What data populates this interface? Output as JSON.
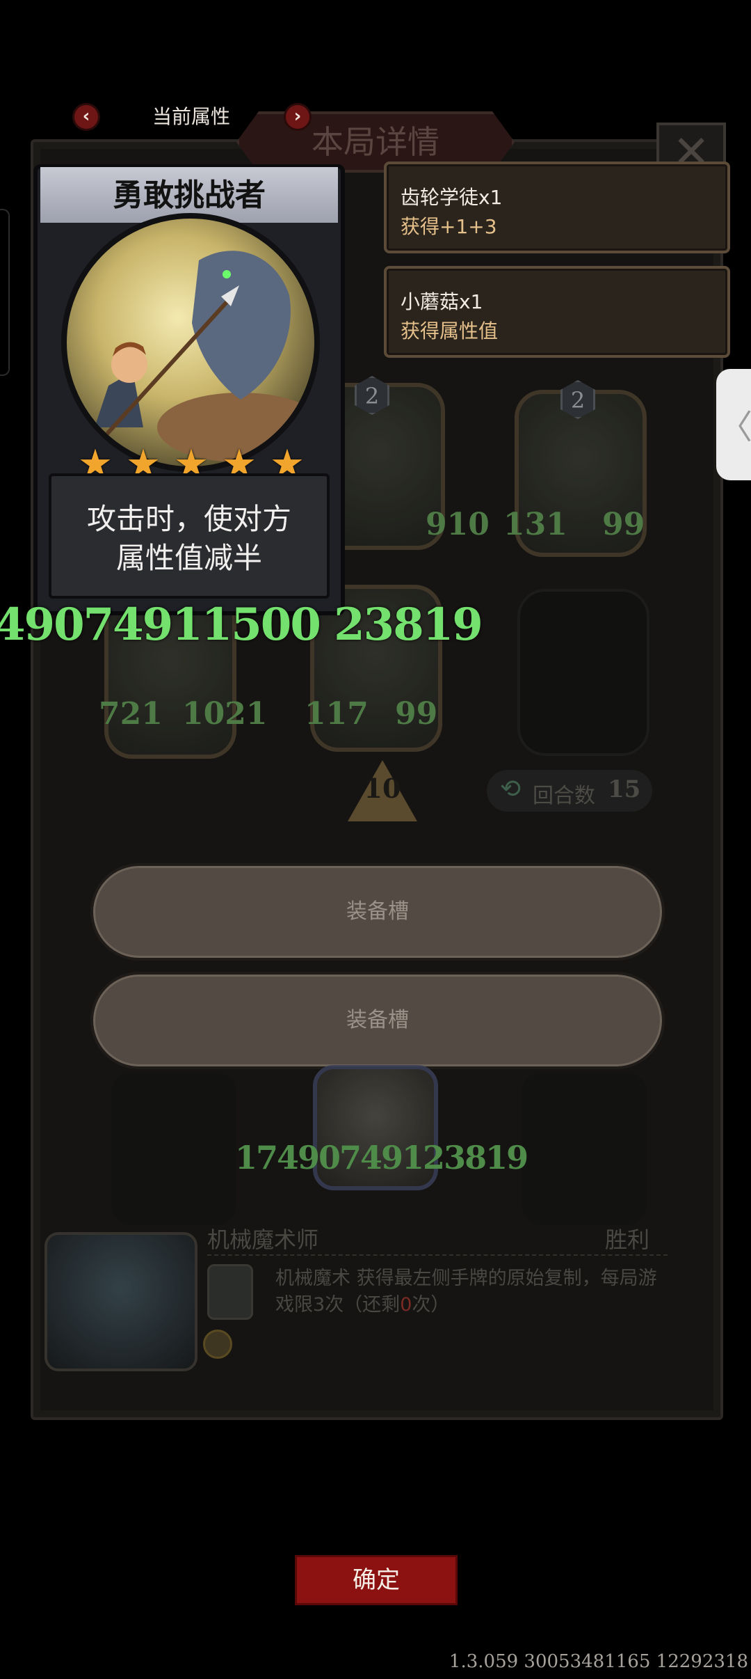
{
  "panel": {
    "title": "本局详情",
    "close_glyph": "✕"
  },
  "attribute_nav": {
    "title": "当前属性",
    "prev_glyph": "‹",
    "next_glyph": "›"
  },
  "card": {
    "name": "勇敢挑战者",
    "stars": 5,
    "star_glyph": "★",
    "description_line1": "攻击时，使对方",
    "description_line2": "属性值减半"
  },
  "rewards": [
    {
      "name": "齿轮学徒x1",
      "effect": "获得+1+3"
    },
    {
      "name": "小蘑菇x1",
      "effect": "获得属性值"
    }
  ],
  "overlay_number": "49074911500 23819",
  "heroes": {
    "top_row": [
      {
        "badge": "2",
        "attack": "",
        "health": "910"
      },
      {
        "badge": "2",
        "attack": "131",
        "health": "99"
      }
    ],
    "second_row": [
      {
        "attack": "721",
        "health": "1021"
      },
      {
        "attack": "117",
        "health": "99"
      }
    ]
  },
  "level": "10",
  "rounds": {
    "icon": "⟲",
    "label": "回合数",
    "value": "15"
  },
  "equipment_slots": [
    "装备槽",
    "装备槽"
  ],
  "player_number": "17490749123819",
  "opponent": {
    "name": "机械魔术师",
    "result": "胜利",
    "skill_name": "机械魔术",
    "skill_text_1": " 获得最左侧手牌的原始复制，每局游戏限3次（还剩",
    "skill_remaining": "0",
    "skill_text_2": "次）"
  },
  "confirm_label": "确定",
  "version": "1.3.059 30053481165 12292318",
  "side_tab_glyph": "〈",
  "colors": {
    "accent_red": "#8c1212",
    "green_number": "#74e06d",
    "star": "#f2a52c"
  }
}
